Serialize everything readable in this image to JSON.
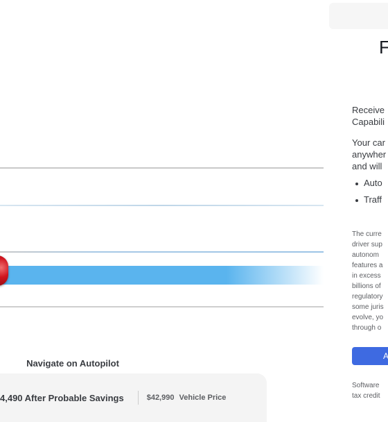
{
  "visual": {
    "caption": "Navigate on Autopilot"
  },
  "price_bar": {
    "savings_text": "4,490 After Probable Savings",
    "vehicle_price_value": "$42,990",
    "vehicle_price_label": "Vehicle Price"
  },
  "panel": {
    "title": "F",
    "intro": "Receive\nCapabili",
    "intro2": "Your car\nanywher\nand will",
    "features": [
      "Auto",
      "Traff"
    ],
    "disclaimer": "The curre\ndriver sup\nautonom\nfeatures a\nin excess\nbillions of\nregulatory\nsome juris\nevolve, yo\nthrough o",
    "add_button_label": "A",
    "footnote": "Software\ntax credit"
  },
  "colors": {
    "accent_button": "#3e6ae1",
    "path_blue": "#5ab4ee",
    "car_red": "#d0141e"
  }
}
